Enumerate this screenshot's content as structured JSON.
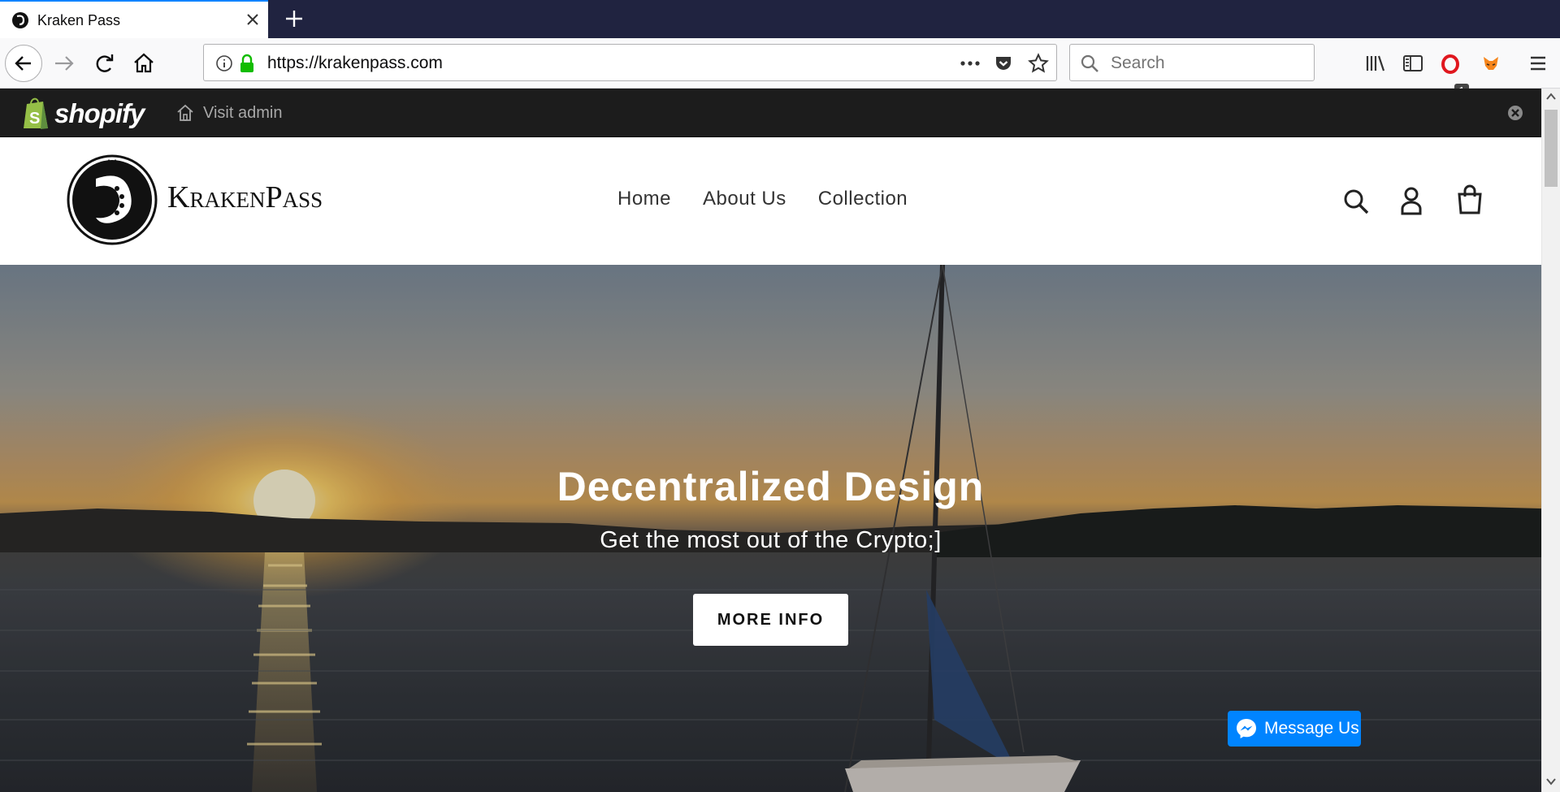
{
  "browser": {
    "tab": {
      "title": "Kraken Pass"
    },
    "url": "https://krakenpass.com",
    "search": {
      "placeholder": "Search"
    },
    "extension_badge": "1",
    "accent_color": "#0a84ff",
    "tabstrip_color": "#202340",
    "icons": [
      "back-icon",
      "forward-icon",
      "reload-icon",
      "home-icon",
      "info-icon",
      "lock-icon",
      "page-actions-icon",
      "pocket-icon",
      "bookmark-star-icon",
      "search-icon",
      "library-icon",
      "sidebar-icon",
      "opera-icon",
      "metamask-icon",
      "hamburger-menu-icon"
    ]
  },
  "admin_bar": {
    "brand": "shopify",
    "visit_admin": "Visit admin",
    "brand_color": "#95bf47"
  },
  "store": {
    "name_first": "Kraken",
    "name_second": "Pass",
    "nav": [
      "Home",
      "About Us",
      "Collection"
    ],
    "icons": [
      "search-icon",
      "account-icon",
      "cart-icon"
    ]
  },
  "hero": {
    "title": "Decentralized Design",
    "subtitle": "Get the most out of the Crypto;]",
    "cta": "MORE INFO"
  },
  "messenger": {
    "label": "Message Us",
    "color": "#0084ff"
  }
}
